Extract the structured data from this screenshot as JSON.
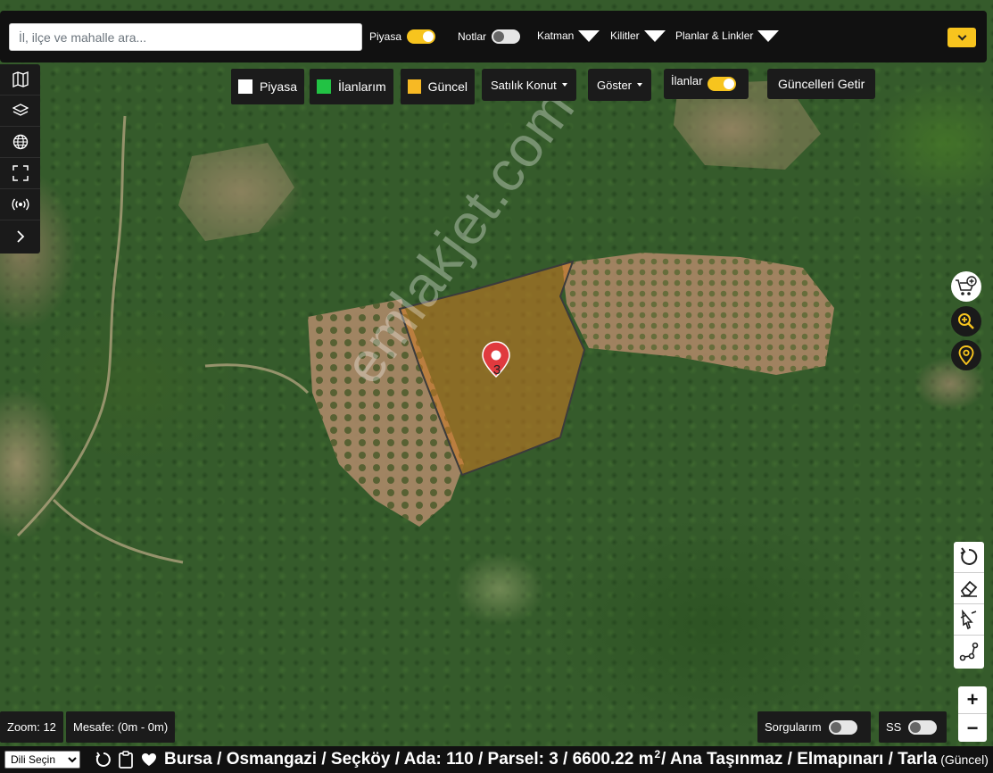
{
  "search": {
    "placeholder": "İl, ilçe ve mahalle ara..."
  },
  "topbar": {
    "piyasa_label": "Piyasa",
    "piyasa_on": true,
    "notlar_label": "Notlar",
    "notlar_on": false,
    "katman_label": "Katman",
    "kilitler_label": "Kilitler",
    "planlar_label": "Planlar & Linkler",
    "expand_icon": "chevron-down-icon"
  },
  "left_toolbar": {
    "icons": [
      "map-icon",
      "layers-icon",
      "globe-icon",
      "fullscreen-icon",
      "broadcast-icon",
      "chevron-right-icon"
    ]
  },
  "legend": {
    "piyasa": {
      "label": "Piyasa",
      "color": "#ffffff"
    },
    "ilanlarim": {
      "label": "İlanlarım",
      "color": "#22c244"
    },
    "guncel": {
      "label": "Güncel",
      "color": "#f7b924"
    }
  },
  "filters": {
    "satilik_konut": "Satılık Konut",
    "goster": "Göster",
    "ilanlar_label": "İlanlar",
    "ilanlar_on": true,
    "guncelleri_getir": "Güncelleri Getir"
  },
  "map": {
    "parcel_marker_label": "3",
    "watermark": "emlakjet.com",
    "parcel_fill": "#d07a22",
    "marker_color": "#e03a3e"
  },
  "right_tools": {
    "icons": [
      "cart-add-icon",
      "zoom-in-icon",
      "location-pin-icon"
    ],
    "draw_icons": [
      "undo-icon",
      "eraser-icon",
      "measure-point-icon",
      "measure-line-icon"
    ],
    "zoom_in": "+",
    "zoom_out": "−"
  },
  "status": {
    "zoom": "Zoom: 12",
    "mesafe": "Mesafe: (0m - 0m)",
    "sorgularim_label": "Sorgularım",
    "sorgularim_on": false,
    "ss_label": "SS",
    "ss_on": false
  },
  "bottombar": {
    "language_select": "Dili Seçin",
    "address_main": "Bursa / Osmangazi / Seçköy / Ada: 110 / Parsel: 3 / 6600.22 m",
    "address_sup": "2",
    "address_rest": " / Ana Taşınmaz / Elmapınarı / Tarla",
    "address_note": "(Güncel)"
  },
  "colors": {
    "accent": "#f7c41e",
    "panel": "#1b1b1b"
  }
}
